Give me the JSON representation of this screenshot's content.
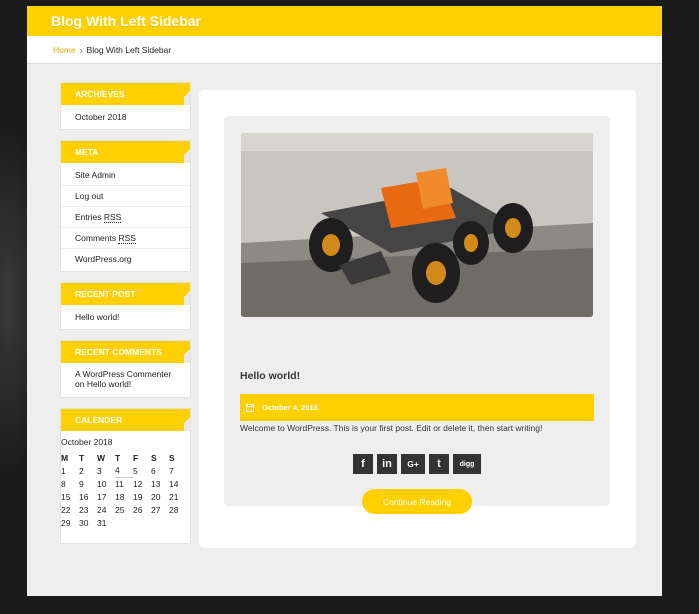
{
  "header": {
    "site_title": "Blog With Left Sidebar"
  },
  "breadcrumb": {
    "home": "Home",
    "separator": "›",
    "current": "Blog With Left Sidebar"
  },
  "sidebar": {
    "archives": {
      "title": "ARCHIEVES",
      "items": [
        "October 2018"
      ]
    },
    "meta": {
      "title": "META",
      "items": [
        {
          "pre": "Site Admin",
          "abbr": ""
        },
        {
          "pre": "Log out",
          "abbr": ""
        },
        {
          "pre": "Entries ",
          "abbr": "RSS"
        },
        {
          "pre": "Comments ",
          "abbr": "RSS"
        },
        {
          "pre": "WordPress.org",
          "abbr": ""
        }
      ]
    },
    "recent_post": {
      "title": "RECENT POST",
      "items": [
        "Hello world!"
      ]
    },
    "recent_comments": {
      "title": "RECENT COMMENTS",
      "text": "A WordPress Commenter on Hello world!"
    },
    "calendar": {
      "title": "CALENDER",
      "caption": "October 2018",
      "weekdays": [
        "M",
        "T",
        "W",
        "T",
        "F",
        "S",
        "S"
      ],
      "weeks": [
        [
          "1",
          "2",
          "3",
          "4",
          "5",
          "6",
          "7"
        ],
        [
          "8",
          "9",
          "10",
          "11",
          "12",
          "13",
          "14"
        ],
        [
          "15",
          "16",
          "17",
          "18",
          "19",
          "20",
          "21"
        ],
        [
          "22",
          "23",
          "24",
          "25",
          "26",
          "27",
          "28"
        ],
        [
          "29",
          "30",
          "31",
          "",
          "",
          "",
          ""
        ]
      ],
      "linked_day": "4"
    }
  },
  "post": {
    "title": "Hello world!",
    "date": "October 4, 2018",
    "excerpt": "Welcome to WordPress. This is your first post. Edit or delete it, then start writing!",
    "share": [
      {
        "name": "facebook-icon",
        "glyph": "f"
      },
      {
        "name": "linkedin-icon",
        "glyph": "in"
      },
      {
        "name": "google-plus-icon",
        "glyph": "G+"
      },
      {
        "name": "twitter-icon",
        "glyph": "t"
      },
      {
        "name": "digg-icon",
        "glyph": "digg"
      }
    ],
    "read_more": "Continue Reading"
  },
  "colors": {
    "accent": "#ffd000",
    "page_bg": "#eeeeee",
    "card_bg": "#ffffff"
  }
}
